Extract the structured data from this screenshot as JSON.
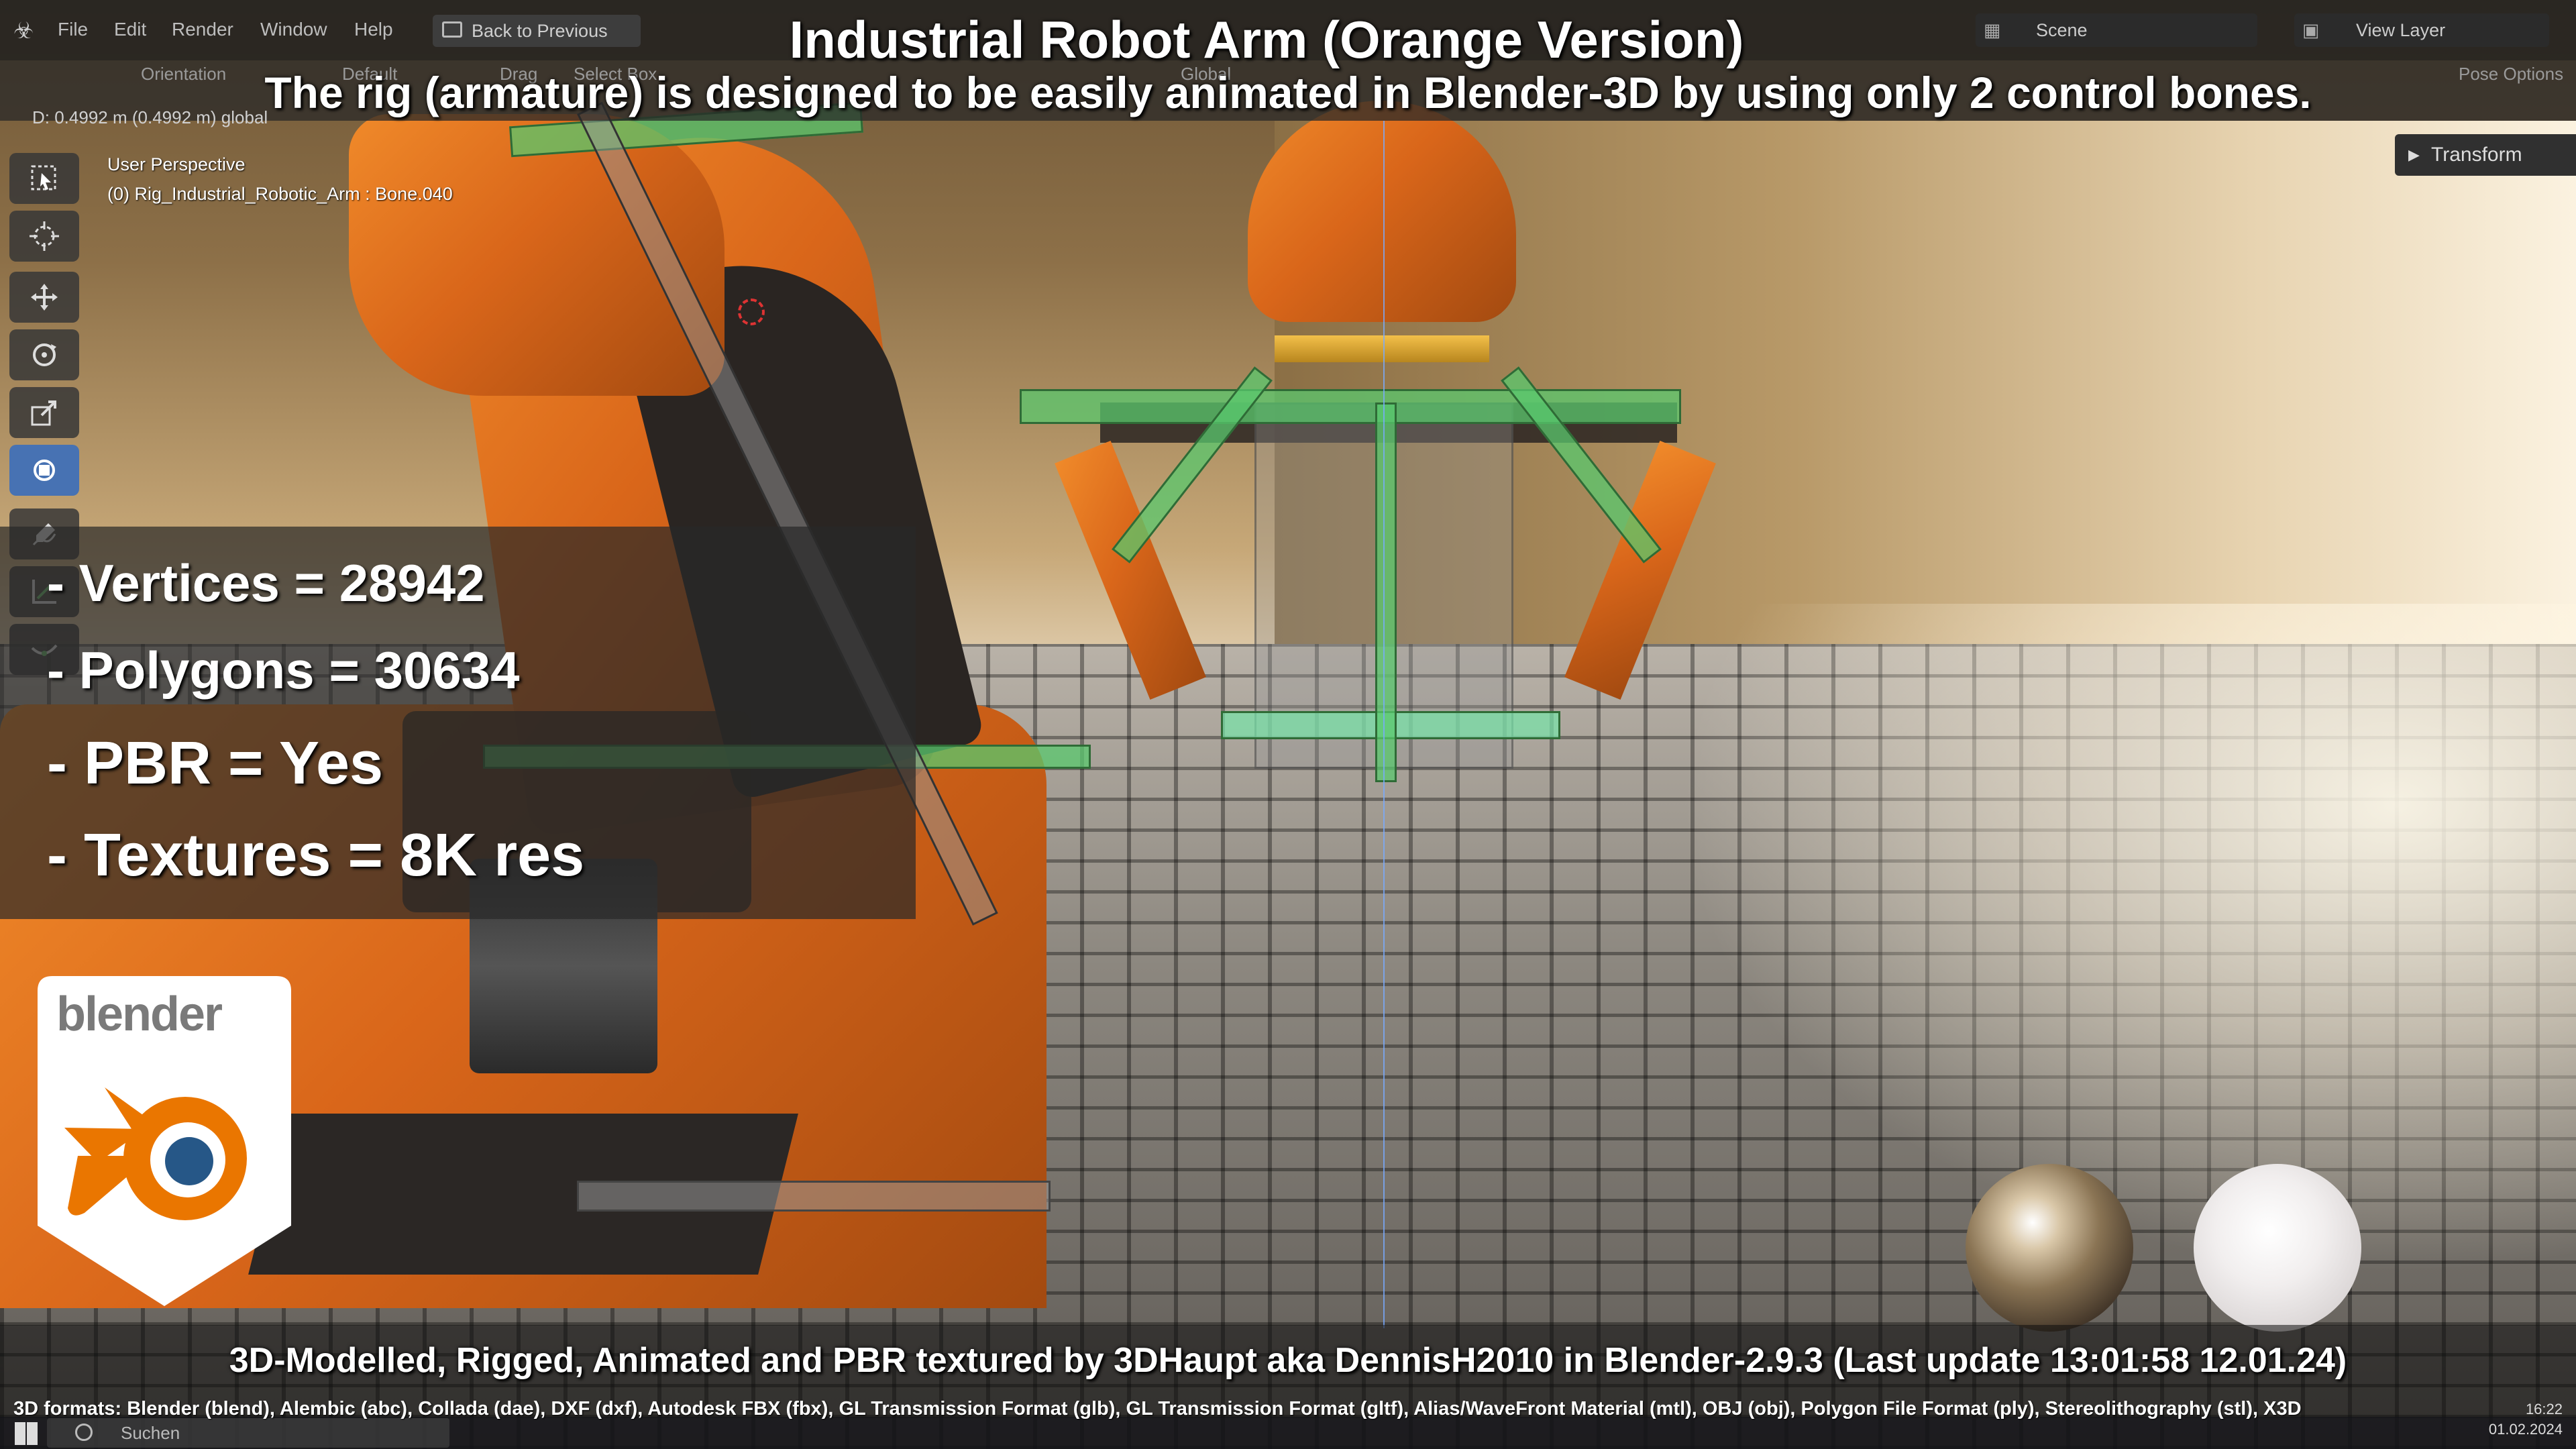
{
  "app": {
    "menu": [
      "File",
      "Edit",
      "Render",
      "Window",
      "Help"
    ],
    "back_button": "Back to Previous",
    "scene": "Scene",
    "view_layer": "View Layer"
  },
  "header": {
    "orientation": "Orientation",
    "orientation_value": "Default",
    "drag_label": "Drag",
    "drag_value": "Select Box",
    "transform_space": "Global",
    "pose_options": "Pose Options",
    "measurement": "D: 0.4992 m (0.4992 m) global"
  },
  "titles": {
    "main": "Industrial Robot Arm (Orange Version)",
    "subtitle": "The rig (armature) is designed to be easily animated in Blender-3D by using only 2 control bones."
  },
  "viewport": {
    "view_name": "User Perspective",
    "active_object": "(0) Rig_Industrial_Robotic_Arm : Bone.040",
    "transform_tab": "Transform"
  },
  "stats": [
    "- Vertices = 28942",
    "- Polygons = 30634",
    "- PBR =  Yes",
    "- Textures = 8K res"
  ],
  "logo": {
    "wordmark": "blender",
    "colors": {
      "orange": "#ea7600",
      "blue": "#265787",
      "white": "#ffffff"
    }
  },
  "footer": {
    "credit": "3D-Modelled, Rigged, Animated and PBR textured by 3DHaupt aka DennisH2010 in Blender-2.9.3 (Last update 13:01:58  12.01.24)",
    "formats": "3D formats: Blender (blend), Alembic (abc), Collada (dae), DXF (dxf), Autodesk FBX (fbx), GL Transmission Format (glb), GL Transmission Format (gltf), Alias/WaveFront Material (mtl), OBJ (obj), Polygon File Format (ply), Stereolithography (stl), X3D"
  },
  "taskbar": {
    "search": "Suchen",
    "time": "16:22",
    "date": "01.02.2024"
  },
  "tools": [
    "select-box-icon",
    "cursor-icon",
    "move-icon",
    "rotate-icon",
    "scale-icon",
    "transform-icon",
    "annotate-icon",
    "measure-icon",
    "bone-roll-icon"
  ],
  "colors": {
    "accent": "#4772b3",
    "robot_orange": "#e07520",
    "bone_green": "#5ac86e"
  }
}
